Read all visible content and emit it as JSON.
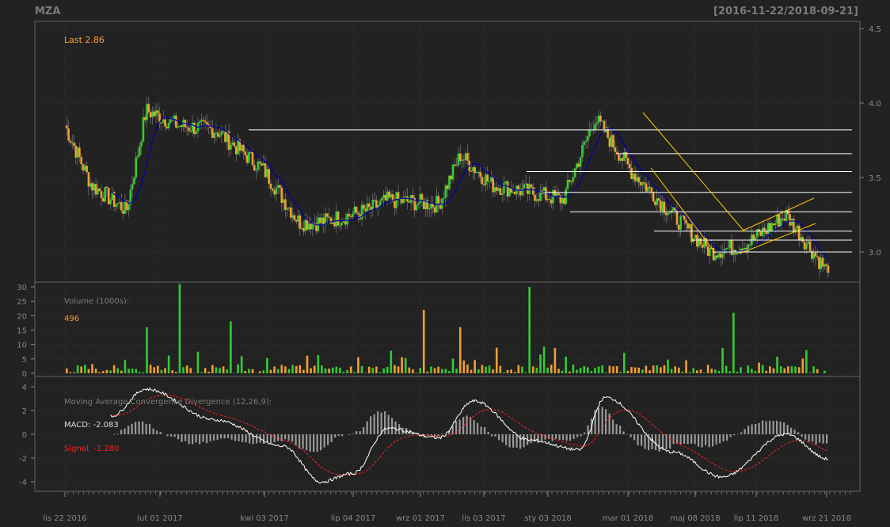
{
  "header": {
    "symbol": "MZA",
    "date_range": "[2016-11-22/2018-09-21]"
  },
  "colors": {
    "background": "#222222",
    "frame": "#666666",
    "grid": "#3a3a3a",
    "text_dim": "#7a7a7a",
    "up": "#33cc33",
    "down": "#f0a030",
    "sma": "#0000aa",
    "hline": "#ffffff",
    "channel": "#ffcc00",
    "macd_line": "#ffffff",
    "signal_line": "#ff2020",
    "histogram": "#9a9a9a",
    "last_label": "#ff9933",
    "signal_label": "#ff2020"
  },
  "price_panel": {
    "last_label": "Last 2.86",
    "y_ticks": [
      "3.0",
      "3.5",
      "4.0",
      "4.5"
    ]
  },
  "volume_panel": {
    "label": "Volume (1000s):",
    "value": "496",
    "y_ticks": [
      "0",
      "5",
      "10",
      "15",
      "20",
      "25",
      "30"
    ]
  },
  "macd_panel": {
    "title": "Moving Average Convergence Divergence (12,26,9):",
    "macd_label": "MACD: -2.083",
    "signal_label": "Signal: -1.280",
    "y_ticks": [
      "-4",
      "-2",
      "0",
      "2",
      "4"
    ]
  },
  "x_axis": {
    "labels": [
      "lis 22 2016",
      "lut 01 2017",
      "kwi 03 2017",
      "lip 04 2017",
      "wrz 01 2017",
      "lis 03 2017",
      "sty 03 2018",
      "mar 01 2018",
      "maj 08 2018",
      "lip 11 2018",
      "wrz 21 2018"
    ]
  },
  "chart_data": {
    "type": "candlestick",
    "symbol": "MZA",
    "period": "2016-11-22/2018-09-21",
    "last_price": 2.86,
    "price_ylim": [
      2.75,
      4.55
    ],
    "price_series_key_points": [
      {
        "t": "2016-11-22",
        "close": 3.85
      },
      {
        "t": "2016-12-15",
        "close": 3.45
      },
      {
        "t": "2017-01-15",
        "close": 3.28
      },
      {
        "t": "2017-02-01",
        "close": 3.95
      },
      {
        "t": "2017-03-01",
        "close": 3.85
      },
      {
        "t": "2017-04-03",
        "close": 3.82
      },
      {
        "t": "2017-05-15",
        "close": 3.55
      },
      {
        "t": "2017-06-15",
        "close": 3.2
      },
      {
        "t": "2017-07-04",
        "close": 3.2
      },
      {
        "t": "2017-08-15",
        "close": 3.28
      },
      {
        "t": "2017-09-01",
        "close": 3.35
      },
      {
        "t": "2017-10-15",
        "close": 3.32
      },
      {
        "t": "2017-11-03",
        "close": 3.65
      },
      {
        "t": "2017-12-01",
        "close": 3.45
      },
      {
        "t": "2018-01-03",
        "close": 3.4
      },
      {
        "t": "2018-02-01",
        "close": 3.35
      },
      {
        "t": "2018-03-01",
        "close": 3.9
      },
      {
        "t": "2018-04-01",
        "close": 3.55
      },
      {
        "t": "2018-05-08",
        "close": 3.25
      },
      {
        "t": "2018-06-10",
        "close": 3.0
      },
      {
        "t": "2018-07-11",
        "close": 3.05
      },
      {
        "t": "2018-08-15",
        "close": 3.25
      },
      {
        "t": "2018-09-21",
        "close": 2.86
      }
    ],
    "horizontal_lines": [
      3.82,
      3.66,
      3.54,
      3.4,
      3.27,
      3.14,
      3.08,
      3.0
    ],
    "volume_ylim": [
      0,
      32
    ],
    "volume_last": 496,
    "volume_peaks": [
      {
        "t": "2017-02-01",
        "volume": 16
      },
      {
        "t": "2017-03-01",
        "volume": 31
      },
      {
        "t": "2017-04-15",
        "volume": 18
      },
      {
        "t": "2017-10-01",
        "volume": 22
      },
      {
        "t": "2017-11-03",
        "volume": 16
      },
      {
        "t": "2018-01-03",
        "volume": 30
      },
      {
        "t": "2018-07-01",
        "volume": 21
      }
    ],
    "macd": {
      "params": "(12,26,9)",
      "macd_last": -2.083,
      "signal_last": -1.28,
      "ylim": [
        -4.5,
        4.5
      ],
      "key_points": [
        {
          "t": "2017-01-01",
          "macd": 1.5
        },
        {
          "t": "2017-02-01",
          "macd": 3.8
        },
        {
          "t": "2017-04-03",
          "macd": 1.2
        },
        {
          "t": "2017-06-01",
          "macd": -1.0
        },
        {
          "t": "2017-07-04",
          "macd": -4.0
        },
        {
          "t": "2017-08-01",
          "macd": -3.3
        },
        {
          "t": "2017-09-01",
          "macd": 0.5
        },
        {
          "t": "2017-10-15",
          "macd": -0.3
        },
        {
          "t": "2017-11-15",
          "macd": 2.8
        },
        {
          "t": "2018-01-03",
          "macd": -0.5
        },
        {
          "t": "2018-02-15",
          "macd": -1.3
        },
        {
          "t": "2018-03-10",
          "macd": 3.1
        },
        {
          "t": "2018-05-08",
          "macd": -1.5
        },
        {
          "t": "2018-06-20",
          "macd": -3.6
        },
        {
          "t": "2018-08-15",
          "macd": 0.0
        },
        {
          "t": "2018-09-21",
          "macd": -2.083
        }
      ]
    }
  }
}
